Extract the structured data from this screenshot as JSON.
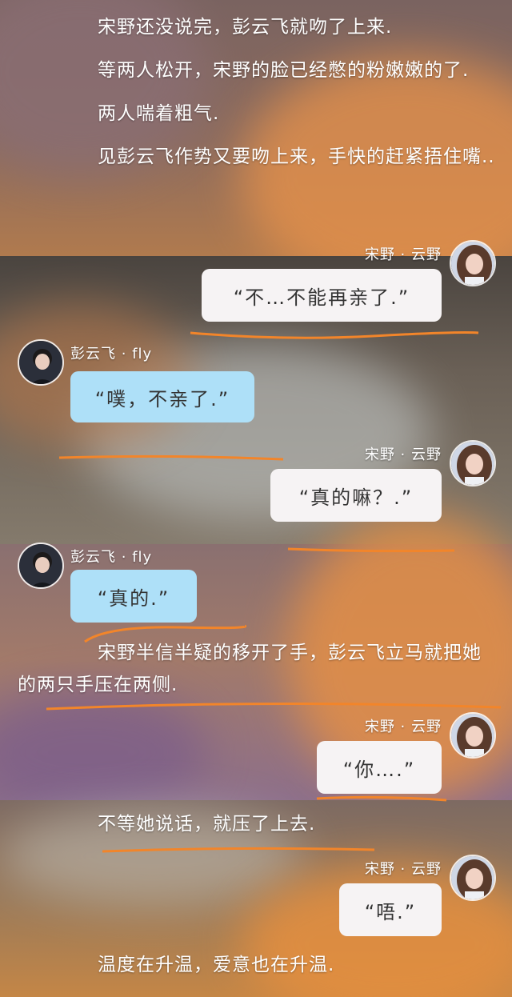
{
  "colors": {
    "me_bubble": "#f6f3f4",
    "other_bubble": "#aee0f8",
    "underline": "#f2852a",
    "text": "#ffffff"
  },
  "narration": {
    "n1": "宋野还没说完，彭云飞就吻了上来.",
    "n2": "等两人松开，宋野的脸已经憋的粉嫩嫩的了.",
    "n3": "两人喘着粗气.",
    "n4": "见彭云飞作势又要吻上来，手快的赶紧捂住嘴..",
    "n5": "宋野半信半疑的移开了手，彭云飞立马就把她的两只手压在两侧.",
    "n6": "不等她说话，就压了上去.",
    "n7": "温度在升温，爱意也在升温."
  },
  "users": {
    "songye": {
      "name": "宋野 · 云野",
      "avatar_icon": "avatar-songye"
    },
    "pengyunfei": {
      "name": "彭云飞 · fly",
      "avatar_icon": "avatar-pengyunfei"
    }
  },
  "messages": {
    "m1": "“不…不能再亲了.”",
    "m2": "“噗，不亲了.”",
    "m3": "“真的嘛？.”",
    "m4": "“真的.”",
    "m5": "“你….”",
    "m6": "“唔.”"
  }
}
